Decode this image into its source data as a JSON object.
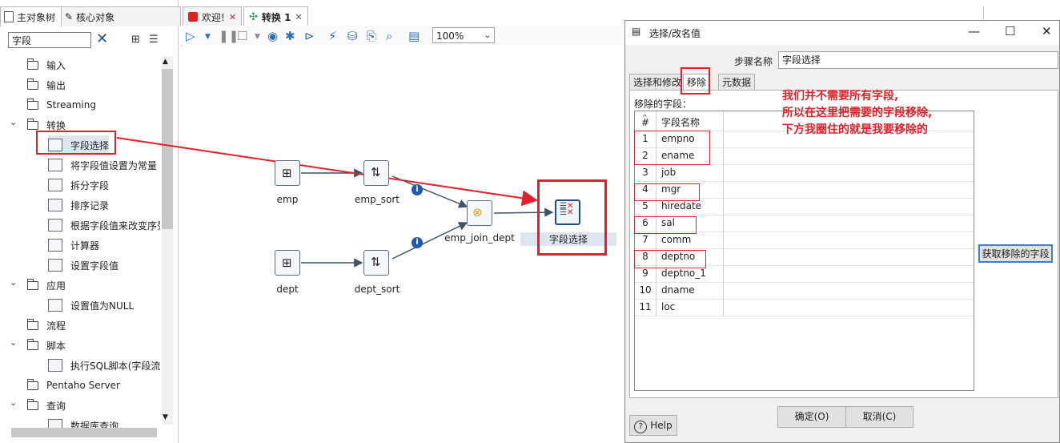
{
  "left_panel": {
    "tabs": [
      {
        "label": "主对象树",
        "icon": "object-tree-icon"
      },
      {
        "label": "核心对象",
        "icon": "pencil-icon"
      }
    ],
    "search": {
      "value": "字段"
    },
    "tree": [
      {
        "label": "输入",
        "type": "folder",
        "level": 1
      },
      {
        "label": "输出",
        "type": "folder",
        "level": 1
      },
      {
        "label": "Streaming",
        "type": "folder",
        "level": 1
      },
      {
        "label": "转换",
        "type": "folder",
        "level": 1,
        "expanded": true
      },
      {
        "label": "字段选择",
        "type": "step",
        "level": 2,
        "selected": true
      },
      {
        "label": "将字段值设置为常量",
        "type": "step",
        "level": 2
      },
      {
        "label": "拆分字段",
        "type": "step",
        "level": 2
      },
      {
        "label": "排序记录",
        "type": "step",
        "level": 2
      },
      {
        "label": "根据字段值来改变序列",
        "type": "step",
        "level": 2
      },
      {
        "label": "计算器",
        "type": "step",
        "level": 2
      },
      {
        "label": "设置字段值",
        "type": "step",
        "level": 2
      },
      {
        "label": "应用",
        "type": "folder",
        "level": 1,
        "expanded": true
      },
      {
        "label": "设置值为NULL",
        "type": "step",
        "level": 2
      },
      {
        "label": "流程",
        "type": "folder",
        "level": 1
      },
      {
        "label": "脚本",
        "type": "folder",
        "level": 1,
        "expanded": true
      },
      {
        "label": "执行SQL脚本(字段流替换)",
        "type": "step",
        "level": 2
      },
      {
        "label": "Pentaho Server",
        "type": "folder",
        "level": 1
      },
      {
        "label": "查询",
        "type": "folder",
        "level": 1,
        "expanded": true
      },
      {
        "label": "数据库查询",
        "type": "step",
        "level": 2
      }
    ]
  },
  "canvas": {
    "tabs": [
      {
        "label": "欢迎!",
        "active": false
      },
      {
        "label": "转换 1",
        "active": true
      }
    ],
    "zoom": "100%",
    "nodes": [
      {
        "id": "emp",
        "label": "emp"
      },
      {
        "id": "emp_sort",
        "label": "emp_sort"
      },
      {
        "id": "dept",
        "label": "dept"
      },
      {
        "id": "dept_sort",
        "label": "dept_sort"
      },
      {
        "id": "emp_join_dept",
        "label": "emp_join_dept"
      },
      {
        "id": "select",
        "label": "字段选择"
      }
    ]
  },
  "dialog": {
    "title": "选择/改名值",
    "step_name_label": "步骤名称",
    "step_name_value": "字段选择",
    "tabs": [
      "选择和修改",
      "移除",
      "元数据"
    ],
    "active_tab": "移除",
    "remove_label": "移除的字段：",
    "grid_headers": [
      "#",
      "字段名称"
    ],
    "rows": [
      {
        "num": "1",
        "name": "empno"
      },
      {
        "num": "2",
        "name": "ename"
      },
      {
        "num": "3",
        "name": "job"
      },
      {
        "num": "4",
        "name": "mgr"
      },
      {
        "num": "5",
        "name": "hiredate"
      },
      {
        "num": "6",
        "name": "sal"
      },
      {
        "num": "7",
        "name": "comm"
      },
      {
        "num": "8",
        "name": "deptno"
      },
      {
        "num": "9",
        "name": "deptno_1"
      },
      {
        "num": "10",
        "name": "dname"
      },
      {
        "num": "11",
        "name": "loc"
      }
    ],
    "get_fields_button": "获取移除的字段",
    "ok_button": "确定(O)",
    "cancel_button": "取消(C)",
    "help_button": "Help",
    "window_buttons": {
      "minimize": "—",
      "maximize": "☐",
      "close": "✕"
    }
  },
  "annotation": {
    "lines": [
      "我们并不需要所有字段,",
      "所以在这里把需要的字段移除,",
      "下方我圈住的就是我要移除的"
    ],
    "color": "#e0202a"
  }
}
